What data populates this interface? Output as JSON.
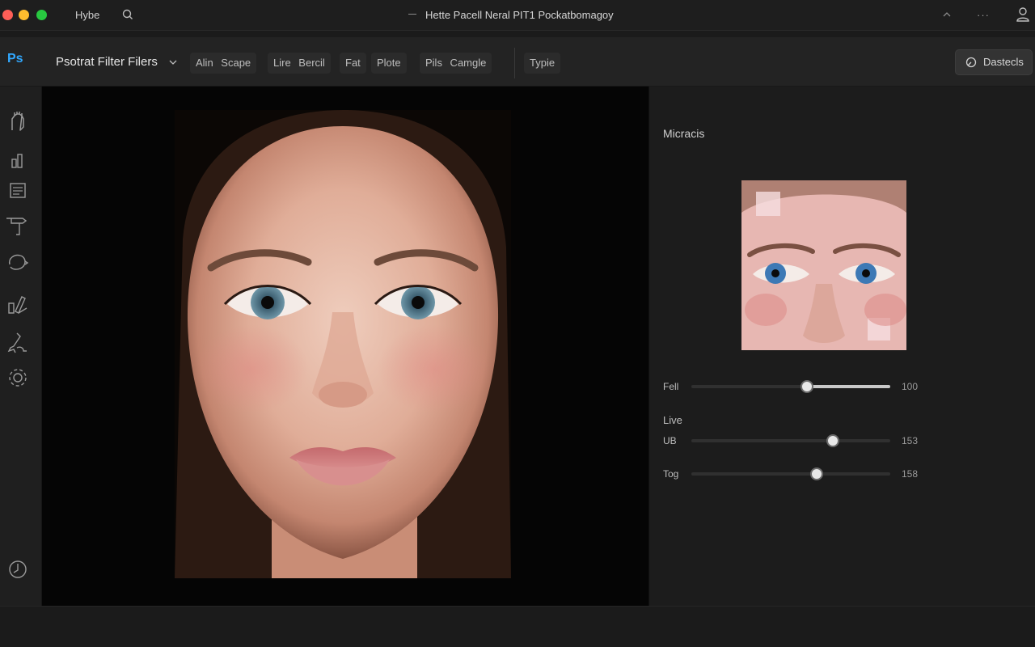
{
  "window": {
    "app_name": "Hybe",
    "title": "Hette Pacell Neral PIT1 Pockatbomagoy",
    "more_label": "···"
  },
  "options_bar": {
    "logo": "Ps",
    "filter_label": "Psotrat Filter Filers",
    "chips": [
      "Alin Scape",
      "Lire Bercil",
      "Fat",
      "Plote",
      "Pils Camgle",
      "Typie"
    ],
    "details_label": "Dastecls"
  },
  "tools": [
    "hand-icon",
    "brush-icon",
    "layers-icon",
    "stamp-icon",
    "lasso-icon",
    "pen-icon",
    "eyedropper-icon",
    "gear-icon",
    "history-icon"
  ],
  "panel": {
    "title": "Micracis",
    "section_label": "Live",
    "sliders": [
      {
        "label": "Fell",
        "value": "100",
        "level": 0.58
      },
      {
        "label": "UB",
        "value": "153",
        "level": 0.71
      },
      {
        "label": "Tog",
        "value": "158",
        "level": 0.63
      }
    ]
  },
  "colors": {
    "ps_blue": "#31a8ff",
    "window_red": "#fe5f57",
    "window_yellow": "#febc2e",
    "window_green": "#28c840"
  }
}
